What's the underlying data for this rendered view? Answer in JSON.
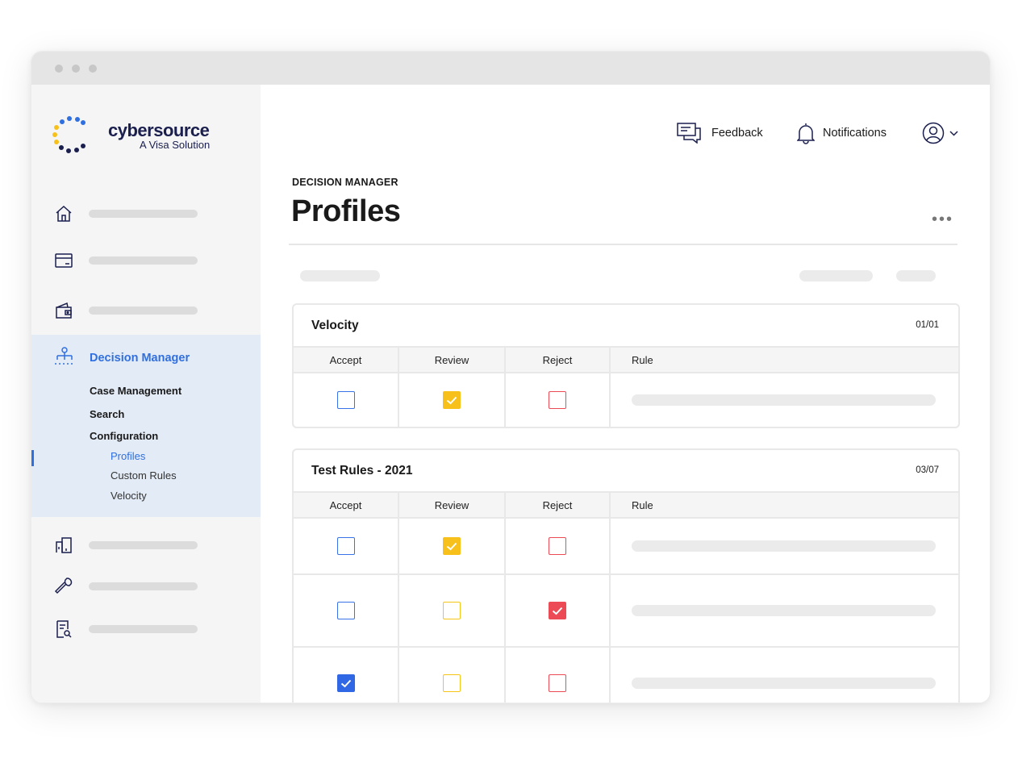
{
  "brand": {
    "name": "cybersource",
    "tagline": "A Visa Solution"
  },
  "colors": {
    "accent": "#2f6fe0",
    "yellow": "#f7c01a",
    "red": "#ec4a54",
    "sidebar_active_bg": "#e3ebf6"
  },
  "sidebar": {
    "top_items": [
      {
        "icon": "home-icon"
      },
      {
        "icon": "card-icon"
      },
      {
        "icon": "wallet-icon"
      }
    ],
    "decision_manager": {
      "icon": "org-chart-icon",
      "label": "Decision Manager",
      "children": [
        {
          "label": "Case Management"
        },
        {
          "label": "Search"
        },
        {
          "label": "Configuration",
          "children": [
            {
              "label": "Profiles",
              "active": true
            },
            {
              "label": "Custom Rules"
            },
            {
              "label": "Velocity"
            }
          ]
        }
      ]
    },
    "bottom_items": [
      {
        "icon": "building-icon"
      },
      {
        "icon": "wrench-icon"
      },
      {
        "icon": "report-search-icon"
      }
    ]
  },
  "header": {
    "feedback_label": "Feedback",
    "notifications_label": "Notifications",
    "user_icon": "user-circle-icon"
  },
  "page": {
    "breadcrumb": "DECISION MANAGER",
    "title": "Profiles",
    "more_label": "•••"
  },
  "columns": [
    "Accept",
    "Review",
    "Reject",
    "Rule"
  ],
  "cards": [
    {
      "title": "Velocity",
      "count": "01/01",
      "rows": [
        {
          "accept": false,
          "review": true,
          "reject": false
        }
      ]
    },
    {
      "title": "Test Rules - 2021",
      "count": "03/07",
      "rows": [
        {
          "accept": false,
          "review": true,
          "reject": false
        },
        {
          "accept": false,
          "review": false,
          "reject": true
        },
        {
          "accept": true,
          "review": false,
          "reject": false
        }
      ]
    }
  ]
}
